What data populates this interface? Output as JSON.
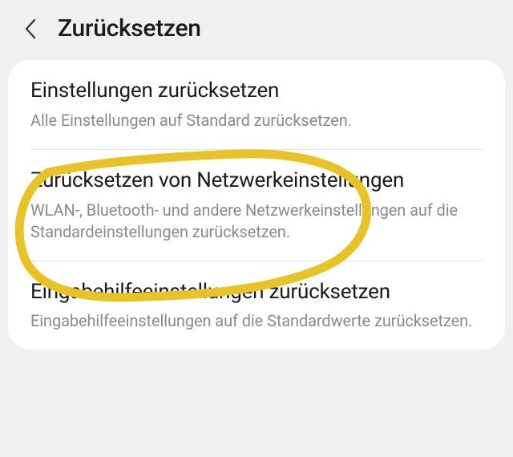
{
  "header": {
    "title": "Zurücksetzen"
  },
  "items": [
    {
      "title": "Einstellungen zurücksetzen",
      "desc": "Alle Einstellungen auf Standard zurücksetzen."
    },
    {
      "title": "Zurücksetzen von Netzwerkeinstellungen",
      "desc": "WLAN-, Bluetooth- und andere Netzwerkeinstellungen auf die Standardeinstellungen zurücksetzen."
    },
    {
      "title": "Eingabehilfeeinstellungen zurücksetzen",
      "desc": "Eingabehilfeeinstellungen auf die Standardwerte zurücksetzen."
    }
  ]
}
